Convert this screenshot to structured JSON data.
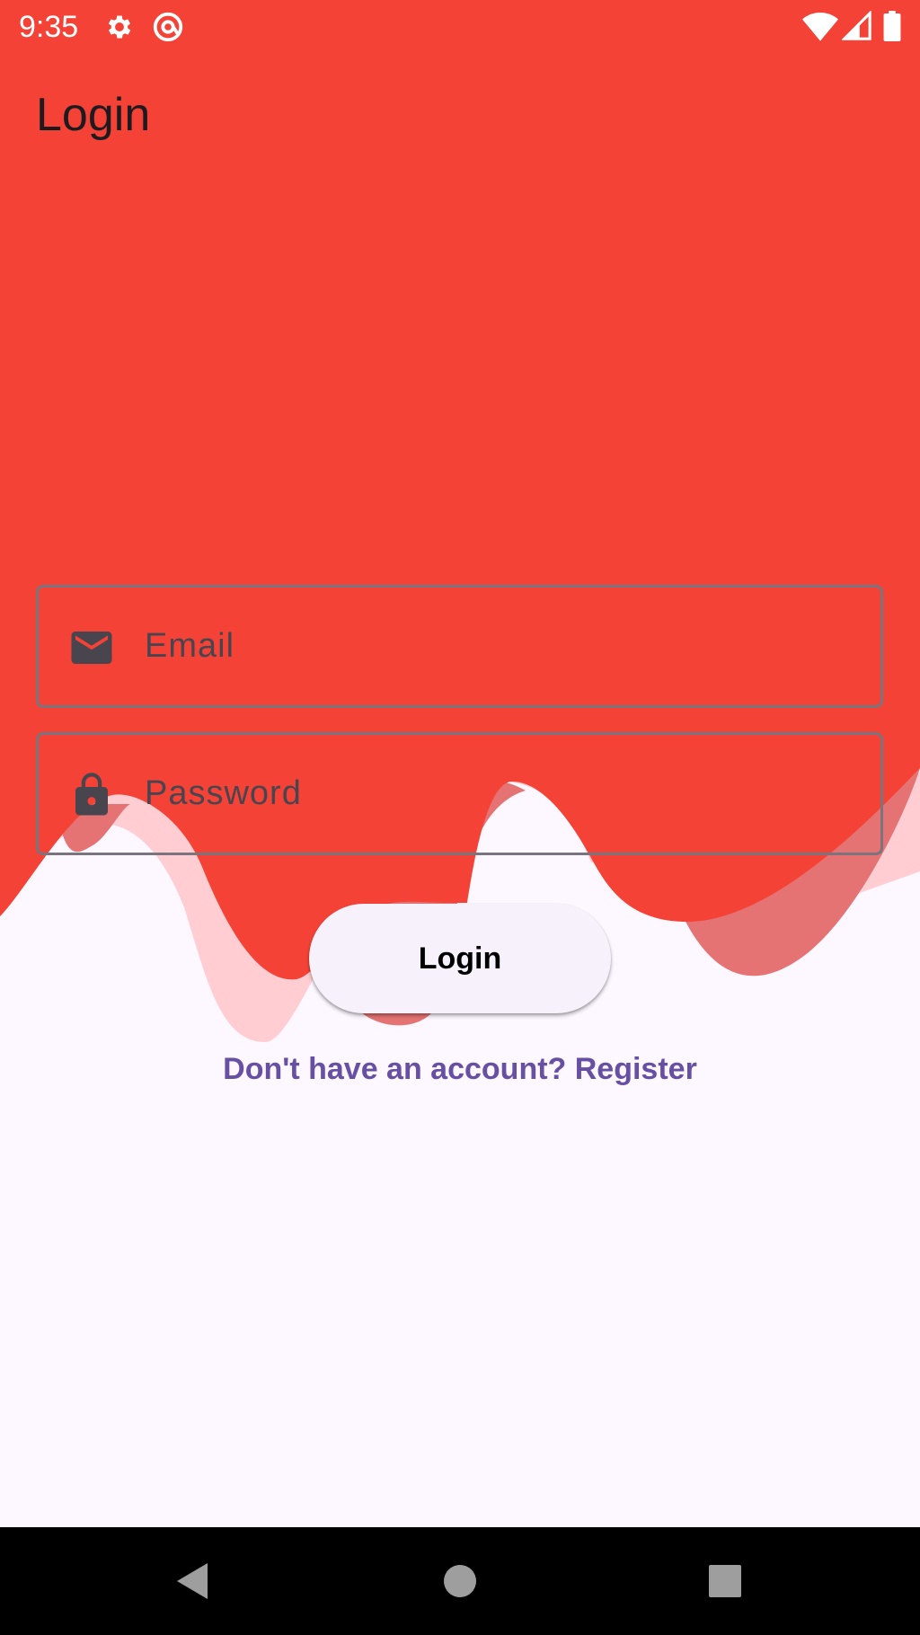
{
  "status_bar": {
    "time": "9:35",
    "icons": [
      "gear-icon",
      "at-sign-icon",
      "wifi-icon",
      "signal-icon",
      "battery-icon"
    ]
  },
  "page": {
    "title": "Login"
  },
  "form": {
    "email": {
      "placeholder": "Email",
      "value": "",
      "icon": "mail-icon"
    },
    "password": {
      "placeholder": "Password",
      "value": "",
      "icon": "lock-icon"
    },
    "login_label": "Login",
    "register_link": "Don't have an account? Register"
  },
  "nav_bar": {
    "icons": [
      "back-icon",
      "home-icon",
      "recents-icon"
    ]
  },
  "colors": {
    "primary_red": "#f44336",
    "wave_dark": "#e57373",
    "wave_light": "#ffcdd2",
    "background": "#fdf7ff",
    "link": "#6750a4"
  }
}
